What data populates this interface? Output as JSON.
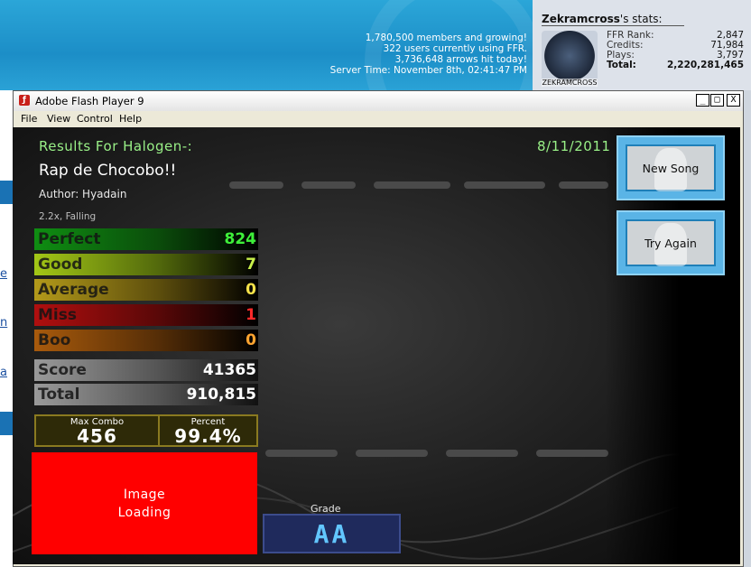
{
  "site": {
    "stats_lines": [
      "1,780,500 members and growing!",
      "322 users currently using FFR.",
      "3,736,648 arrows hit today!",
      "Server Time: November 8th, 02:41:47 PM"
    ]
  },
  "user_stats": {
    "username": "Zekramcross",
    "title_suffix": "'s stats:",
    "avatar_caption": "ZEKRAMCROSS",
    "rows": [
      {
        "label": "FFR Rank:",
        "value": "2,847"
      },
      {
        "label": "Credits:",
        "value": "71,984"
      },
      {
        "label": "Plays:",
        "value": "3,797"
      },
      {
        "label": "Total:",
        "value": "2,220,281,465"
      }
    ]
  },
  "window": {
    "title": "Adobe Flash Player 9",
    "menu": [
      "File",
      "View",
      "Control",
      "Help"
    ],
    "controls": {
      "minimize": "_",
      "maximize": "□",
      "close": "X"
    }
  },
  "results": {
    "header": "Results For Halogen-:",
    "date": "8/11/2011",
    "song_title": "Rap de Chocobo!!",
    "author": "Author: Hyadain",
    "settings": "2.2x, Falling",
    "judgements": [
      {
        "label": "Perfect",
        "value": "824"
      },
      {
        "label": "Good",
        "value": "7"
      },
      {
        "label": "Average",
        "value": "0"
      },
      {
        "label": "Miss",
        "value": "1"
      },
      {
        "label": "Boo",
        "value": "0"
      }
    ],
    "score_label": "Score",
    "score": "41365",
    "total_label": "Total",
    "total": "910,815",
    "max_combo_label": "Max Combo",
    "max_combo": "456",
    "percent_label": "Percent",
    "percent": "99.4%",
    "image_loading": "Image\nLoading",
    "grade_label": "Grade",
    "grade": "AA"
  },
  "buttons": {
    "new_song": "New Song",
    "try_again": "Try Again"
  },
  "colors": {
    "accent_green": "#99f087",
    "perfect": "#3ef03a",
    "miss": "#ff2a2a",
    "button_blue": "#5ab4e6",
    "grade_blue": "#62c6ff"
  }
}
